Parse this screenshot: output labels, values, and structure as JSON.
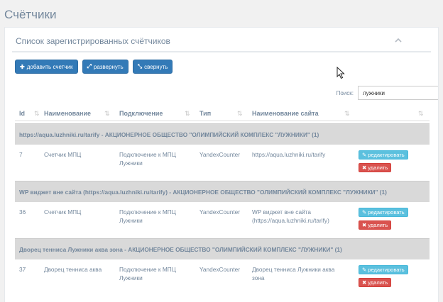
{
  "page": {
    "title": "Счётчики"
  },
  "panel": {
    "title": "Список зарегистрированных счётчиков"
  },
  "toolbar": {
    "add_label": "добавить счетчик",
    "expand_label": "развернуть",
    "collapse_label": "свернуть"
  },
  "search": {
    "label": "Поиск:",
    "value": "лужники"
  },
  "table": {
    "headers": [
      "Id",
      "Наименование",
      "Подключение",
      "Тип",
      "Наименование сайта"
    ],
    "edit_label": "редактировать",
    "delete_label": "удалить",
    "groups": [
      {
        "title": "https://aqua.luzhniki.ru/tarify - АКЦИОНЕРНОЕ ОБЩЕСТВО \"ОЛИМПИЙСКИЙ КОМПЛЕКС \"ЛУЖНИКИ\" (1)",
        "row": {
          "id": "7",
          "name": "Счетчик МПЦ",
          "connection_1": "Подключение к МПЦ",
          "connection_2": "Лужники",
          "type": "YandexCounter",
          "site_1": "https://aqua.luzhniki.ru/tarify",
          "site_2": ""
        }
      },
      {
        "title": "WP виджет вне сайта (https://aqua.luzhniki.ru/tarify) - АКЦИОНЕРНОЕ ОБЩЕСТВО \"ОЛИМПИЙСКИЙ КОМПЛЕКС \"ЛУЖНИКИ\" (1)",
        "row": {
          "id": "36",
          "name": "Счетчик МПЦ",
          "connection_1": "Подключение к МПЦ",
          "connection_2": "Лужники",
          "type": "YandexCounter",
          "site_1": "WP виджет вне сайта",
          "site_2": "(https://aqua.luzhniki.ru/tarify)"
        }
      },
      {
        "title": "Дворец тенниса Лужники аква зона - АКЦИОНЕРНОЕ ОБЩЕСТВО \"ОЛИМПИЙСКИЙ КОМПЛЕКС \"ЛУЖНИКИ\" (1)",
        "row": {
          "id": "37",
          "name": "Дворец тенниса аква",
          "connection_1": "Подключение к МПЦ",
          "connection_2": "Лужники",
          "type": "YandexCounter",
          "site_1": "Дворец тенниса Лужники аква",
          "site_2": "зона"
        }
      }
    ]
  },
  "icons": {
    "add": "plus-icon",
    "expand": "expand-icon",
    "collapse": "compress-icon",
    "edit": "pencil-icon",
    "delete": "times-icon",
    "sort": "sort-icon",
    "panel_toggle": "chevron-up-icon"
  },
  "colors": {
    "primary": "#337ab7",
    "info": "#5bc0de",
    "danger": "#d9534f",
    "text": "#73879c",
    "group_bg": "#d9d9d9"
  }
}
